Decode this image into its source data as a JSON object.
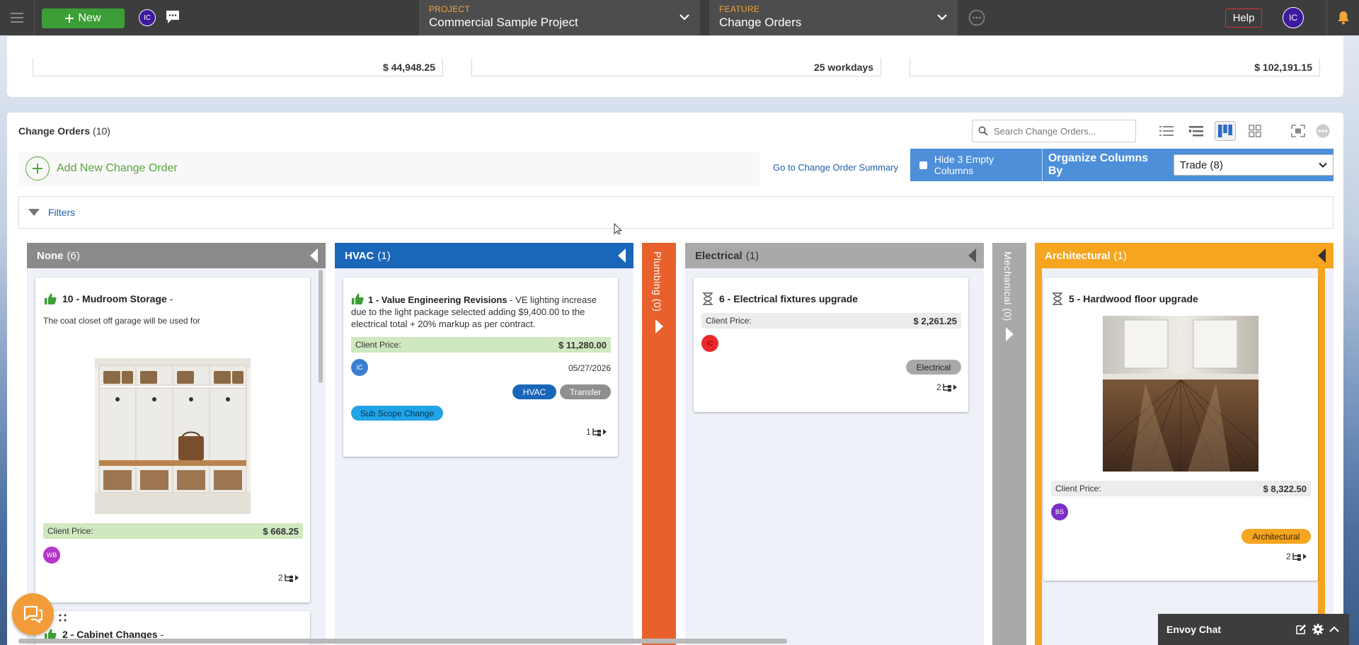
{
  "nav": {
    "new_label": "New",
    "user_initials": "IC",
    "project": {
      "label": "PROJECT",
      "value": "Commercial Sample Project"
    },
    "feature": {
      "label": "FEATURE",
      "value": "Change Orders"
    },
    "help_label": "Help",
    "account_initials": "IC"
  },
  "summary": {
    "values": [
      "$ 44,948.25",
      "25 workdays",
      "$ 102,191.15"
    ]
  },
  "section": {
    "title": "Change Orders",
    "count": "(10)",
    "search_placeholder": "Search Change Orders...",
    "add_label": "Add New Change Order",
    "summary_link": "Go to Change Order Summary",
    "hide_empty_label": "Hide 3 Empty Columns",
    "organize_label": "Organize Columns By",
    "organize_value": "Trade (8)",
    "filters_label": "Filters"
  },
  "columns": {
    "none": {
      "name": "None",
      "count": "(6)",
      "color": "#8a8a8a"
    },
    "hvac": {
      "name": "HVAC",
      "count": "(1)",
      "color": "#1a66b8"
    },
    "plumbing": {
      "label": "Plumbing (0)",
      "color": "#e8612d"
    },
    "electrical": {
      "name": "Electrical",
      "count": "(1)",
      "color": "#a9a9a9"
    },
    "mechanical": {
      "label": "Mechanical (0)",
      "color": "#a9a9a9"
    },
    "architectural": {
      "name": "Architectural",
      "count": "(1)",
      "color": "#f5a520"
    }
  },
  "cards": {
    "mudroom": {
      "number": "10",
      "title": "Mudroom Storage",
      "suffix": "-",
      "description": "The coat closet off garage will be used for",
      "price_label": "Client Price:",
      "price": "$ 668.25",
      "assignee": "WB",
      "subitems": "2"
    },
    "cabinet": {
      "number": "2",
      "title": "Cabinet Changes",
      "suffix": "-"
    },
    "hvac": {
      "number": "1",
      "title": "Value Engineering Revisions",
      "description": " - VE lighting increase due to the light package selected adding $9,400.00 to the electrical total + 20% markup as per contract.",
      "price_label": "Client Price:",
      "price": "$ 11,280.00",
      "assignee": "IC",
      "date": "05/27/2026",
      "tag1": "HVAC",
      "tag2": "Transfer",
      "tag3": "Sub Scope Change",
      "subitems": "1"
    },
    "electrical": {
      "number": "6",
      "title": "Electrical fixtures upgrade",
      "price_label": "Client Price:",
      "price": "$ 2,261.25",
      "assignee": "IC",
      "tag": "Electrical",
      "subitems": "2"
    },
    "architectural": {
      "number": "5",
      "title": "Hardwood floor upgrade",
      "price_label": "Client Price:",
      "price": "$ 8,322.50",
      "assignee": "BS",
      "tag": "Architectural",
      "subitems": "2"
    }
  },
  "chat": {
    "title": "Envoy Chat"
  },
  "colors": {
    "green": "#3d9e37",
    "accent_blue": "#4d8fd9",
    "nav_dark": "#3d3d3d",
    "orange": "#f29b38"
  }
}
